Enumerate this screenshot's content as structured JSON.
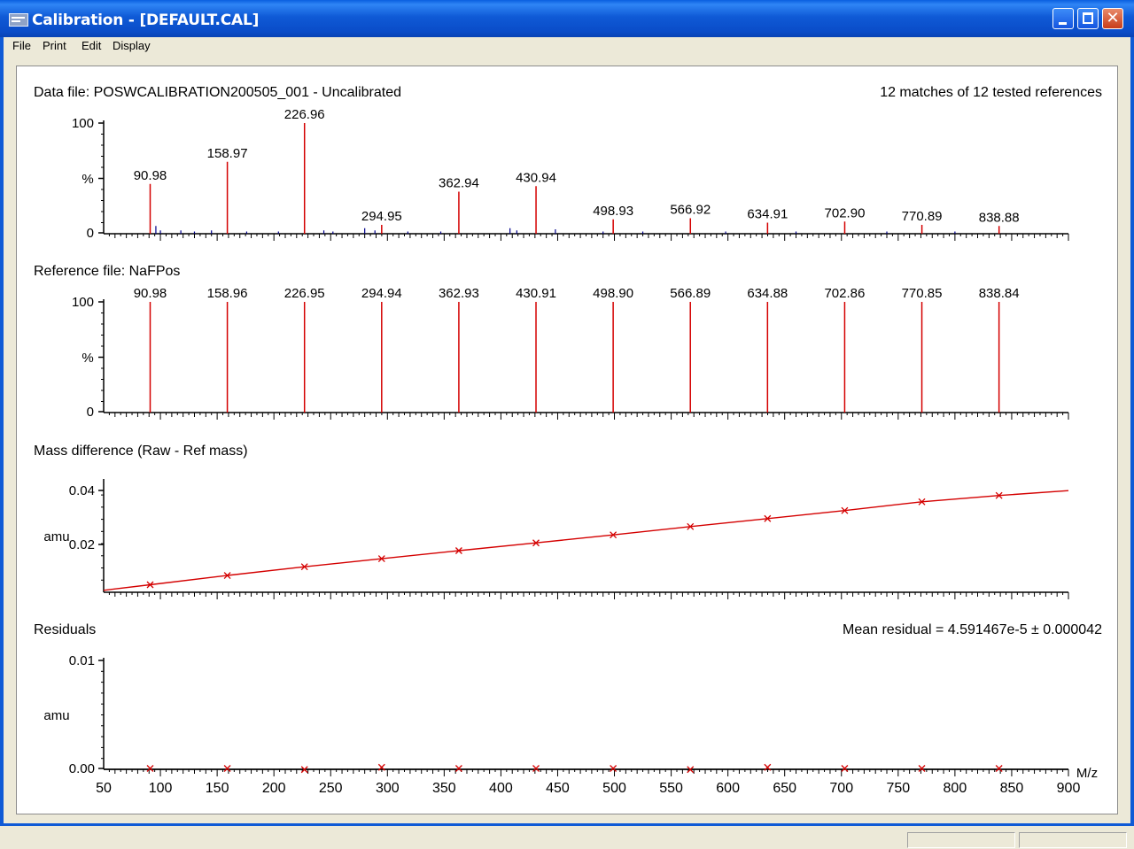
{
  "window": {
    "title": "Calibration - [DEFAULT.CAL]",
    "minimize_icon": "minimize-icon",
    "maximize_icon": "maximize-icon",
    "close_icon": "close-icon",
    "close_glyph": "✕"
  },
  "menu": [
    "File",
    "Print",
    "Edit",
    "Display"
  ],
  "colors": {
    "trace_red": "#d40000",
    "noise_blue": "#00008b",
    "titlebar": "#0a4cc8"
  },
  "chart_data": [
    {
      "type": "bar",
      "title": "Data file: POSWCALIBRATION200505_001 - Uncalibrated",
      "annotation": "12 matches of 12 tested references",
      "ylabel": "%",
      "y_ticks": [
        "100",
        "0"
      ],
      "x_range": [
        50,
        900
      ],
      "ylim": [
        0,
        100
      ],
      "peaks": [
        {
          "x": 90.98,
          "label": "90.98",
          "y": 45
        },
        {
          "x": 158.97,
          "label": "158.97",
          "y": 65
        },
        {
          "x": 226.96,
          "label": "226.96",
          "y": 100
        },
        {
          "x": 294.95,
          "label": "294.95",
          "y": 8
        },
        {
          "x": 362.94,
          "label": "362.94",
          "y": 38
        },
        {
          "x": 430.94,
          "label": "430.94",
          "y": 43
        },
        {
          "x": 498.93,
          "label": "498.93",
          "y": 13
        },
        {
          "x": 566.92,
          "label": "566.92",
          "y": 14
        },
        {
          "x": 634.91,
          "label": "634.91",
          "y": 10
        },
        {
          "x": 702.9,
          "label": "702.90",
          "y": 11
        },
        {
          "x": 770.89,
          "label": "770.89",
          "y": 8
        },
        {
          "x": 838.88,
          "label": "838.88",
          "y": 7
        }
      ],
      "noise": [
        {
          "x": 96,
          "y": 7
        },
        {
          "x": 100,
          "y": 3
        },
        {
          "x": 118,
          "y": 3
        },
        {
          "x": 130,
          "y": 2
        },
        {
          "x": 145,
          "y": 3
        },
        {
          "x": 176,
          "y": 2
        },
        {
          "x": 204,
          "y": 2
        },
        {
          "x": 244,
          "y": 3
        },
        {
          "x": 252,
          "y": 2
        },
        {
          "x": 280,
          "y": 5
        },
        {
          "x": 289,
          "y": 3
        },
        {
          "x": 318,
          "y": 2
        },
        {
          "x": 347,
          "y": 2
        },
        {
          "x": 408,
          "y": 5
        },
        {
          "x": 414,
          "y": 3
        },
        {
          "x": 448,
          "y": 4
        },
        {
          "x": 490,
          "y": 2
        },
        {
          "x": 525,
          "y": 2
        },
        {
          "x": 598,
          "y": 2
        },
        {
          "x": 660,
          "y": 2
        },
        {
          "x": 740,
          "y": 2
        },
        {
          "x": 800,
          "y": 2
        }
      ]
    },
    {
      "type": "bar",
      "title": "Reference file: NaFPos",
      "ylabel": "%",
      "y_ticks": [
        "100",
        "0"
      ],
      "x_range": [
        50,
        900
      ],
      "ylim": [
        0,
        100
      ],
      "peaks": [
        {
          "x": 90.98,
          "label": "90.98",
          "y": 100
        },
        {
          "x": 158.96,
          "label": "158.96",
          "y": 100
        },
        {
          "x": 226.95,
          "label": "226.95",
          "y": 100
        },
        {
          "x": 294.94,
          "label": "294.94",
          "y": 100
        },
        {
          "x": 362.93,
          "label": "362.93",
          "y": 100
        },
        {
          "x": 430.91,
          "label": "430.91",
          "y": 100
        },
        {
          "x": 498.9,
          "label": "498.90",
          "y": 100
        },
        {
          "x": 566.89,
          "label": "566.89",
          "y": 100
        },
        {
          "x": 634.88,
          "label": "634.88",
          "y": 100
        },
        {
          "x": 702.86,
          "label": "702.86",
          "y": 100
        },
        {
          "x": 770.85,
          "label": "770.85",
          "y": 100
        },
        {
          "x": 838.84,
          "label": "838.84",
          "y": 100
        }
      ]
    },
    {
      "type": "line",
      "title": "Mass difference (Raw - Ref mass)",
      "ylabel": "amu",
      "y_ticks": [
        "0.04",
        "0.02"
      ],
      "x_range": [
        50,
        900
      ],
      "ylim": [
        0.0,
        0.0455
      ],
      "curve_x": [
        50,
        90.98,
        158.96,
        226.95,
        294.94,
        362.93,
        430.91,
        498.9,
        566.89,
        634.88,
        702.86,
        770.85,
        838.84,
        900
      ],
      "curve_y": [
        0.0008,
        0.0031,
        0.0069,
        0.0105,
        0.0138,
        0.0171,
        0.0203,
        0.0236,
        0.027,
        0.0303,
        0.0336,
        0.0372,
        0.0398,
        0.0418
      ],
      "points_x": [
        90.98,
        158.96,
        226.95,
        294.94,
        362.93,
        430.91,
        498.9,
        566.89,
        634.88,
        702.86,
        770.85,
        838.84
      ],
      "points_y": [
        0.0031,
        0.0069,
        0.0105,
        0.0138,
        0.0171,
        0.0203,
        0.0236,
        0.027,
        0.0303,
        0.0336,
        0.0372,
        0.0398
      ]
    },
    {
      "type": "scatter",
      "title": "Residuals",
      "annotation": "Mean residual = 4.591467e-5 ± 0.000042",
      "ylabel": "amu",
      "xlabel": "M/z",
      "y_ticks": [
        "0.01",
        "0.00"
      ],
      "x_ticks": [
        "50",
        "100",
        "150",
        "200",
        "250",
        "300",
        "350",
        "400",
        "450",
        "500",
        "550",
        "600",
        "650",
        "700",
        "750",
        "800",
        "850",
        "900"
      ],
      "x_range": [
        50,
        900
      ],
      "ylim": [
        0.0,
        0.01
      ],
      "points_x": [
        90.98,
        158.96,
        226.95,
        294.94,
        362.93,
        430.91,
        498.9,
        566.89,
        634.88,
        702.86,
        770.85,
        838.84
      ],
      "points_y": [
        0.0,
        0.0,
        -0.0001,
        0.0001,
        0.0,
        0.0,
        0.0,
        -0.0001,
        0.0001,
        0.0,
        0.0,
        0.0
      ]
    }
  ]
}
